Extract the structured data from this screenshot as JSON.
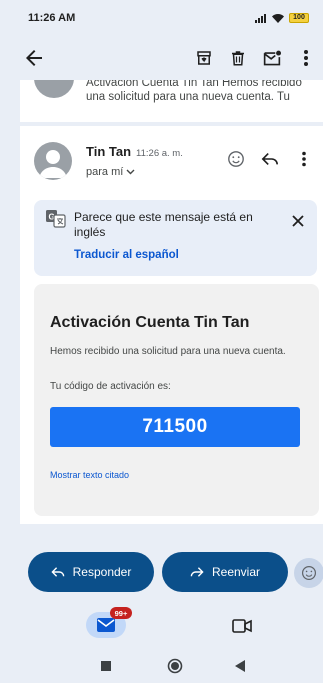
{
  "status_bar": {
    "time": "11:26 AM",
    "battery": "100"
  },
  "colors": {
    "background": "#e9eef6",
    "accent": "#0b57d0",
    "code_box": "#1a73f3",
    "pill": "#0b4f8a",
    "badge": "#c5221f"
  },
  "app_bar": {
    "icons": [
      "back-arrow-icon",
      "archive-icon",
      "delete-icon",
      "mark-unread-icon",
      "more-vert-icon"
    ]
  },
  "previous_message": {
    "snippet": "Activación Cuenta Tin Tan Hemos recibido una solicitud para una nueva cuenta. Tu"
  },
  "message": {
    "sender": "Tin Tan",
    "time": "11:26 a. m.",
    "recipient": "para mí",
    "translate": {
      "text": "Parece que este mensaje está en inglés",
      "link": "Traducir al español"
    },
    "body": {
      "heading": "Activación Cuenta Tin Tan",
      "paragraph": "Hemos recibido una solicitud para una nueva cuenta.",
      "code_label": "Tu código de activación es:",
      "code": "711500",
      "quoted_link": "Mostrar texto citado"
    }
  },
  "reply_bar": {
    "reply_label": "Responder",
    "forward_label": "Reenviar"
  },
  "bottom_nav": {
    "mail_badge": "99+"
  }
}
